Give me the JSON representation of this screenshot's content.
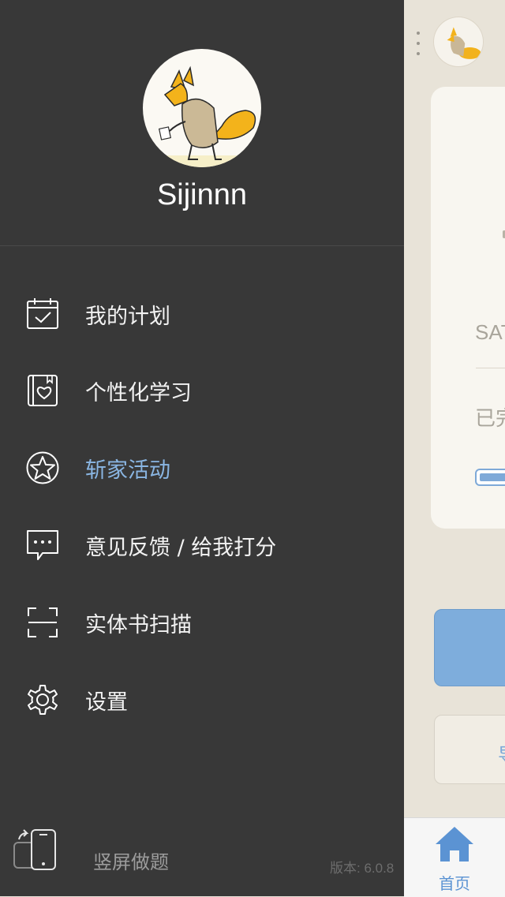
{
  "background": {
    "card_label_1": "SAT",
    "card_label_2": "已完",
    "secondary_button_text": "导",
    "tab_home_label": "首页"
  },
  "drawer": {
    "username": "Sijinnn",
    "menu": [
      {
        "label": "我的计划",
        "icon": "calendar-check-icon",
        "active": false
      },
      {
        "label": "个性化学习",
        "icon": "heart-book-icon",
        "active": false
      },
      {
        "label": "斩家活动",
        "icon": "star-circle-icon",
        "active": true
      },
      {
        "label": "意见反馈 / 给我打分",
        "icon": "chat-bubble-icon",
        "active": false
      },
      {
        "label": "实体书扫描",
        "icon": "scan-frame-icon",
        "active": false
      },
      {
        "label": "设置",
        "icon": "gear-icon",
        "active": false
      }
    ],
    "bottom_label": "竖屏做题",
    "version": "版本: 6.0.8"
  },
  "colors": {
    "drawer_bg": "#383838",
    "accent": "#8ab6e3",
    "tab_active": "#5b93d3"
  }
}
